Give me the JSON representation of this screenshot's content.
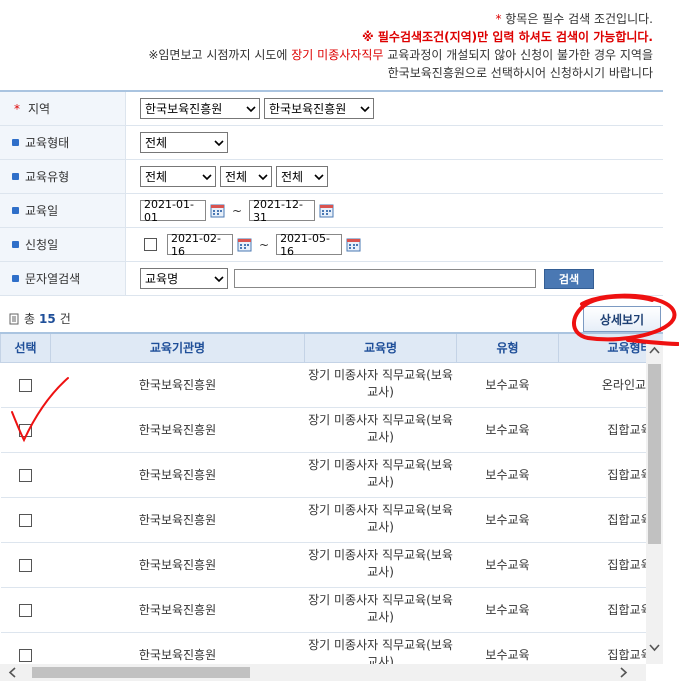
{
  "notice": {
    "line1_star": "*",
    "line1": " 항목은 필수 검색 조건입니다.",
    "line2": "※ 필수검색조건(지역)만 입력 하셔도 검색이 가능합니다.",
    "line3_pre": "※임면보고 시점까지 시도에 ",
    "line3_em": "장기 미종사자직무",
    "line3_post": " 교육과정이 개설되지 않아 신청이 불가한 경우 지역을",
    "line4": "한국보육진흥원으로 선택하시어 신청하시기 바랍니다"
  },
  "form": {
    "region": {
      "label": "지역",
      "required": "*",
      "sido": "한국보육진흥원",
      "sigungu": "한국보육진흥원"
    },
    "edu_form": {
      "label": "교육형태",
      "value": "전체"
    },
    "edu_type": {
      "label": "교육유형",
      "v1": "전체",
      "v2": "전체",
      "v3": "전체"
    },
    "edu_date": {
      "label": "교육일",
      "from": "2021-01-01",
      "to": "2021-12-31"
    },
    "apply_date": {
      "label": "신청일",
      "from": "2021-02-16",
      "to": "2021-05-16"
    },
    "keyword": {
      "label": "문자열검색",
      "field": "교육명",
      "value": "",
      "search_btn": "검색"
    }
  },
  "total": {
    "prefix": "총",
    "count": "15",
    "suffix": "건"
  },
  "detail_button": "상세보기",
  "table": {
    "headers": [
      "선택",
      "교육기관명",
      "교육명",
      "유형",
      "교육형태"
    ],
    "rows": [
      {
        "org": "한국보육진흥원",
        "name": "장기 미종사자 직무교육(보육교사)",
        "type": "보수교육",
        "form": "온라인교육"
      },
      {
        "org": "한국보육진흥원",
        "name": "장기 미종사자 직무교육(보육교사)",
        "type": "보수교육",
        "form": "집합교육"
      },
      {
        "org": "한국보육진흥원",
        "name": "장기 미종사자 직무교육(보육교사)",
        "type": "보수교육",
        "form": "집합교육"
      },
      {
        "org": "한국보육진흥원",
        "name": "장기 미종사자 직무교육(보육교사)",
        "type": "보수교육",
        "form": "집합교육"
      },
      {
        "org": "한국보육진흥원",
        "name": "장기 미종사자 직무교육(보육교사)",
        "type": "보수교육",
        "form": "집합교육"
      },
      {
        "org": "한국보육진흥원",
        "name": "장기 미종사자 직무교육(보육교사)",
        "type": "보수교육",
        "form": "집합교육"
      },
      {
        "org": "한국보육진흥원",
        "name": "장기 미종사자 직무교육(보육교사)",
        "type": "보수교육",
        "form": "집합교육"
      }
    ]
  },
  "colors": {
    "accent": "#1f4f99",
    "required": "#dd0000",
    "annotation": "#ee1111"
  }
}
